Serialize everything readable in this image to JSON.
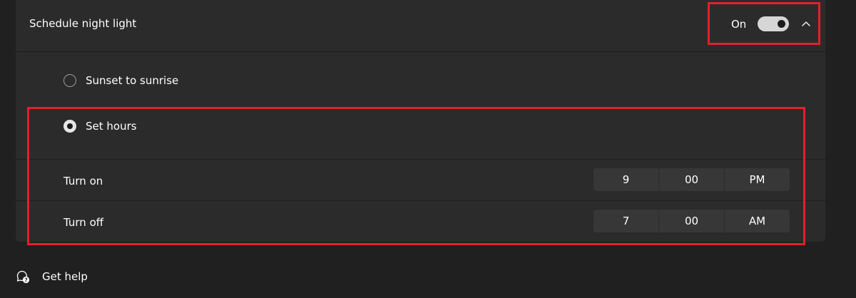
{
  "schedule": {
    "label": "Schedule night light",
    "toggle_state": "On",
    "toggle_on": true
  },
  "options": [
    {
      "label": "Sunset to sunrise",
      "selected": false
    },
    {
      "label": "Set hours",
      "selected": true
    }
  ],
  "turn_on": {
    "label": "Turn on",
    "hour": "9",
    "minute": "00",
    "period": "PM"
  },
  "turn_off": {
    "label": "Turn off",
    "hour": "7",
    "minute": "00",
    "period": "AM"
  },
  "help": {
    "label": "Get help"
  },
  "colors": {
    "background": "#202020",
    "card": "#2b2b2b",
    "highlight": "#e3202a",
    "toggle_track": "#d6d6d6"
  }
}
